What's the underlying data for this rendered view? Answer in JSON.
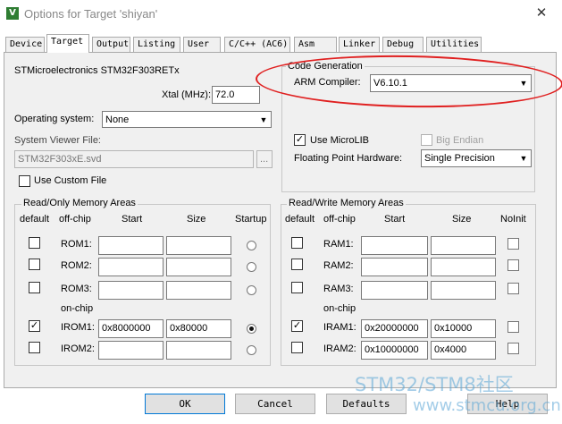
{
  "window": {
    "title": "Options for Target 'shiyan'",
    "app_icon_letter": "V",
    "close_glyph": "✕"
  },
  "tabs": [
    "Device",
    "Target",
    "Output",
    "Listing",
    "User",
    "C/C++ (AC6)",
    "Asm",
    "Linker",
    "Debug",
    "Utilities"
  ],
  "active_tab": "Target",
  "target": {
    "device_name": "STMicroelectronics STM32F303RETx",
    "xtal_label": "Xtal (MHz):",
    "xtal_value": "72.0",
    "os_label": "Operating system:",
    "os_value": "None",
    "svd_label": "System Viewer File:",
    "svd_value": "STM32F303xE.svd",
    "svd_browse": "...",
    "use_custom_file_label": "Use Custom File"
  },
  "code_generation": {
    "title": "Code Generation",
    "compiler_label": "ARM Compiler:",
    "compiler_value": "V6.10.1",
    "use_microlib_label": "Use MicroLIB",
    "use_microlib_checked": true,
    "big_endian_label": "Big Endian",
    "fp_label": "Floating Point Hardware:",
    "fp_value": "Single Precision"
  },
  "ro_memory": {
    "title": "Read/Only Memory Areas",
    "headers": {
      "default": "default",
      "offchip": "off-chip",
      "start": "Start",
      "size": "Size",
      "startup": "Startup"
    },
    "onchip_label": "on-chip",
    "rows": [
      {
        "name": "ROM1:",
        "start": "",
        "size": "",
        "default": false,
        "startup": false
      },
      {
        "name": "ROM2:",
        "start": "",
        "size": "",
        "default": false,
        "startup": false
      },
      {
        "name": "ROM3:",
        "start": "",
        "size": "",
        "default": false,
        "startup": false
      },
      {
        "name": "IROM1:",
        "start": "0x8000000",
        "size": "0x80000",
        "default": true,
        "startup": true
      },
      {
        "name": "IROM2:",
        "start": "",
        "size": "",
        "default": false,
        "startup": false
      }
    ]
  },
  "rw_memory": {
    "title": "Read/Write Memory Areas",
    "headers": {
      "default": "default",
      "offchip": "off-chip",
      "start": "Start",
      "size": "Size",
      "noinit": "NoInit"
    },
    "onchip_label": "on-chip",
    "rows": [
      {
        "name": "RAM1:",
        "start": "",
        "size": "",
        "default": false,
        "noinit": false
      },
      {
        "name": "RAM2:",
        "start": "",
        "size": "",
        "default": false,
        "noinit": false
      },
      {
        "name": "RAM3:",
        "start": "",
        "size": "",
        "default": false,
        "noinit": false
      },
      {
        "name": "IRAM1:",
        "start": "0x20000000",
        "size": "0x10000",
        "default": true,
        "noinit": false
      },
      {
        "name": "IRAM2:",
        "start": "0x10000000",
        "size": "0x4000",
        "default": false,
        "noinit": false
      }
    ]
  },
  "buttons": {
    "ok": "OK",
    "cancel": "Cancel",
    "defaults": "Defaults",
    "help": "Help"
  },
  "watermark": {
    "line1": "STM32/STM8社区",
    "line2": "www.stmcu.org.cn"
  },
  "colors": {
    "highlight_ring": "#e02020",
    "watermark": "#5aa6d6"
  }
}
